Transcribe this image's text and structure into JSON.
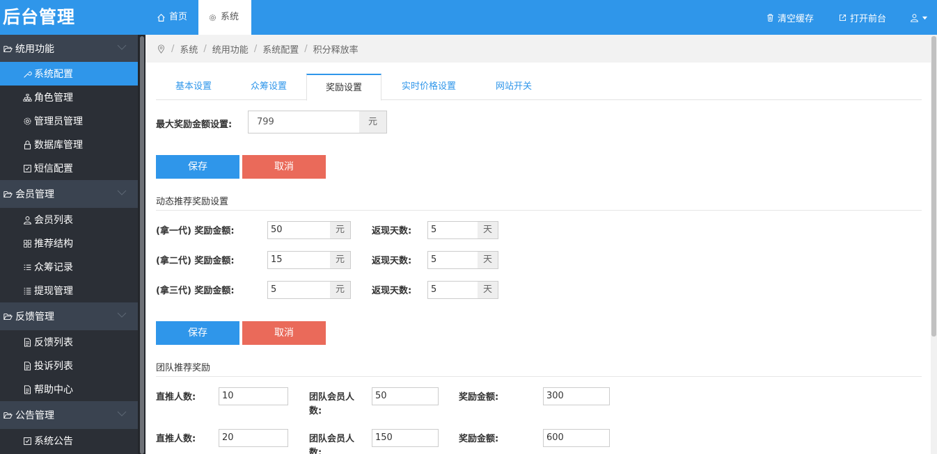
{
  "header": {
    "brand": "后台管理",
    "tabs": [
      {
        "label": "首页",
        "icon": "home-icon"
      },
      {
        "label": "系统",
        "icon": "gear-icon"
      }
    ],
    "clear_cache": "清空缓存",
    "open_frontend": "打开前台"
  },
  "sidebar": {
    "groups": [
      {
        "label": "统用功能",
        "items": [
          "系统配置",
          "角色管理",
          "管理员管理",
          "数据库管理",
          "短信配置"
        ]
      },
      {
        "label": "会员管理",
        "items": [
          "会员列表",
          "推荐结构",
          "众筹记录",
          "提现管理"
        ]
      },
      {
        "label": "反馈管理",
        "items": [
          "反馈列表",
          "投诉列表",
          "帮助中心"
        ]
      },
      {
        "label": "公告管理",
        "items": [
          "系统公告"
        ]
      }
    ]
  },
  "breadcrumb": [
    "系统",
    "统用功能",
    "系统配置",
    "积分释放率"
  ],
  "tabs": [
    "基本设置",
    "众筹设置",
    "奖励设置",
    "实时价格设置",
    "网站开关"
  ],
  "active_tab": "奖励设置",
  "max_reward": {
    "label": "最大奖励金额设置:",
    "value": "799",
    "unit": "元"
  },
  "buttons": {
    "save": "保存",
    "cancel": "取消"
  },
  "dynamic": {
    "title": "动态推荐奖励设置",
    "rows": [
      {
        "label": "(拿一代) 奖励金额:",
        "amount": "50",
        "unit": "元",
        "days_label": "返现天数:",
        "days": "5",
        "days_unit": "天"
      },
      {
        "label": "(拿二代) 奖励金额:",
        "amount": "15",
        "unit": "元",
        "days_label": "返现天数:",
        "days": "5",
        "days_unit": "天"
      },
      {
        "label": "(拿三代) 奖励金额:",
        "amount": "5",
        "unit": "元",
        "days_label": "返现天数:",
        "days": "5",
        "days_unit": "天"
      }
    ]
  },
  "team": {
    "title": "团队推荐奖励",
    "direct_label": "直推人数:",
    "team_label_line1": "团队会员人",
    "team_label_line2": "数:",
    "reward_label": "奖励金额:",
    "rows": [
      {
        "direct": "10",
        "team": "50",
        "reward": "300"
      },
      {
        "direct": "20",
        "team": "150",
        "reward": "600"
      }
    ]
  }
}
